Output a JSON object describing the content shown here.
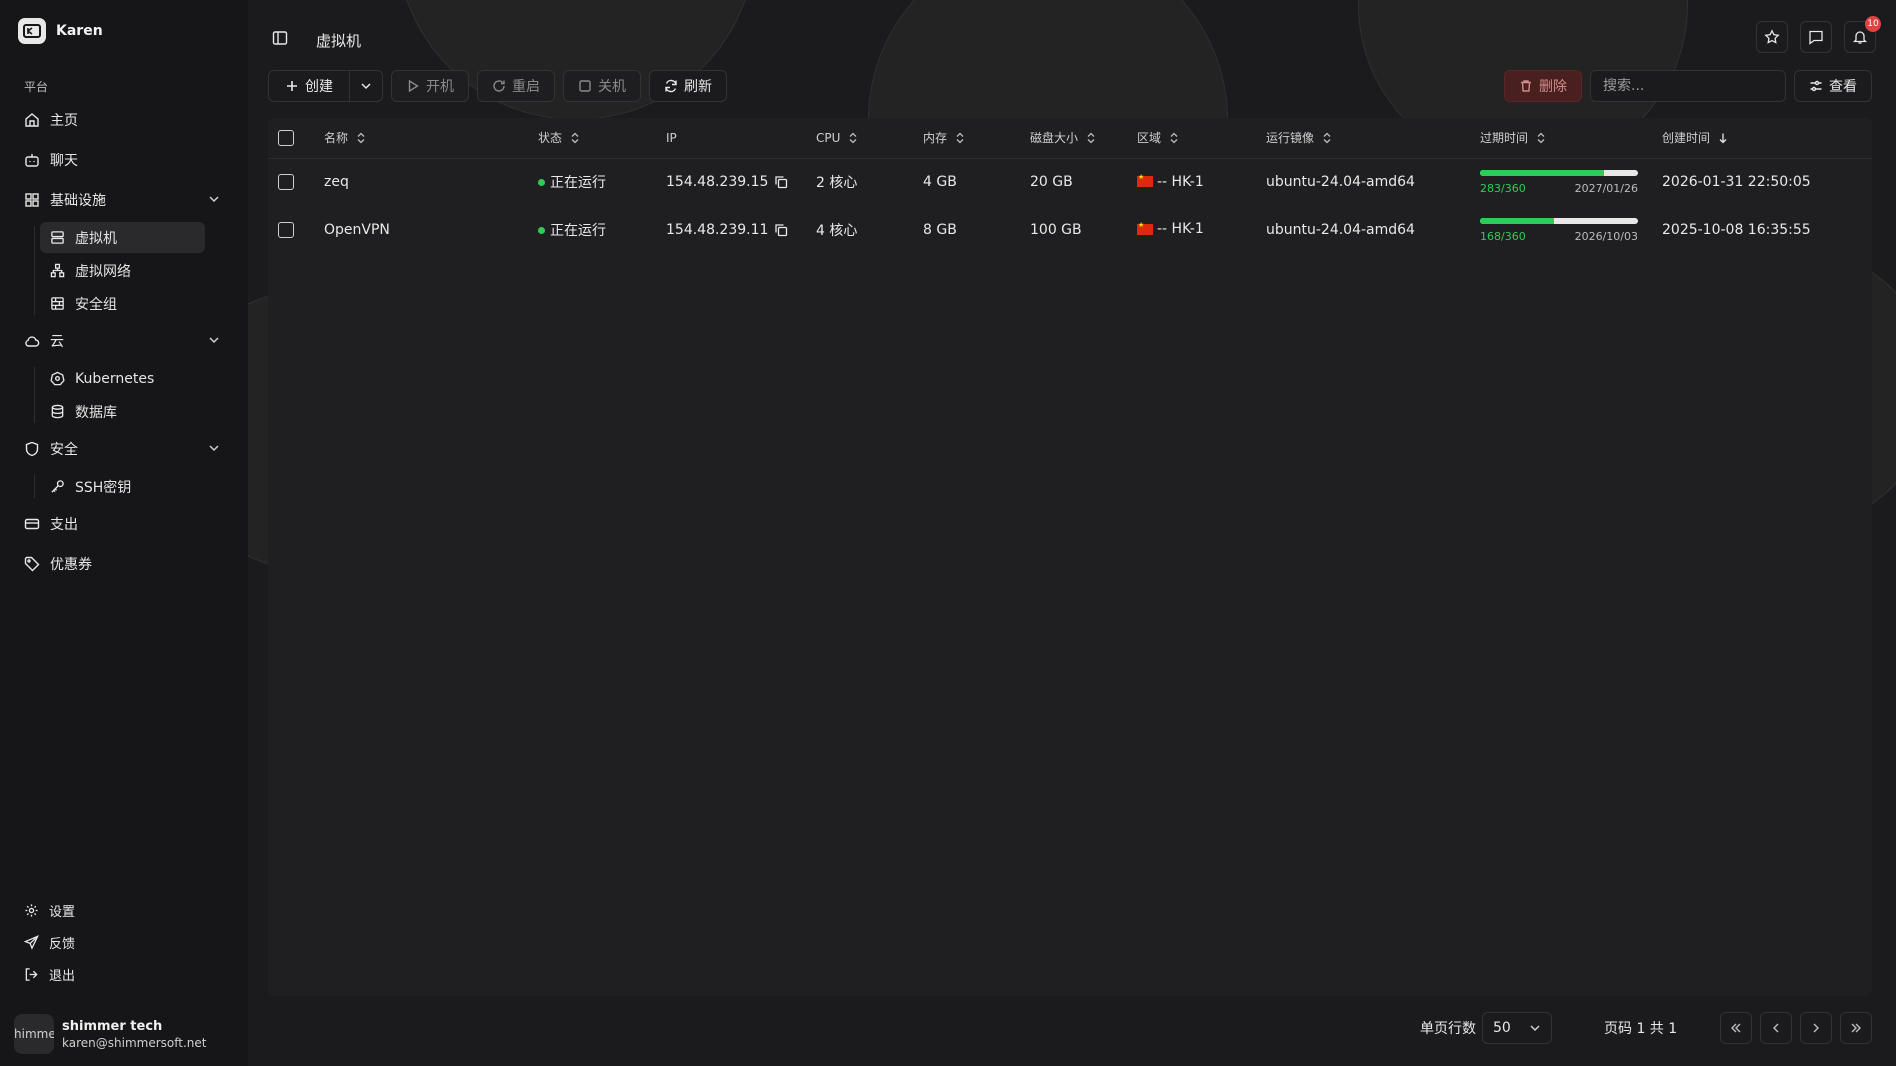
{
  "app": {
    "name": "Karen"
  },
  "sidebar": {
    "section_label": "平台",
    "items": [
      {
        "label": "主页",
        "icon": "home-icon"
      },
      {
        "label": "聊天",
        "icon": "bot-icon"
      },
      {
        "label": "基础设施",
        "icon": "grid-icon",
        "expanded": true,
        "children": [
          {
            "label": "虚拟机",
            "icon": "server-icon",
            "active": true
          },
          {
            "label": "虚拟网络",
            "icon": "network-icon"
          },
          {
            "label": "安全组",
            "icon": "firewall-icon"
          }
        ]
      },
      {
        "label": "云",
        "icon": "cloud-icon",
        "expanded": true,
        "children": [
          {
            "label": "Kubernetes",
            "icon": "kubernetes-icon"
          },
          {
            "label": "数据库",
            "icon": "database-icon"
          }
        ]
      },
      {
        "label": "安全",
        "icon": "shield-icon",
        "expanded": true,
        "children": [
          {
            "label": "SSH密钥",
            "icon": "key-icon"
          }
        ]
      },
      {
        "label": "支出",
        "icon": "credit-card-icon"
      },
      {
        "label": "优惠券",
        "icon": "tag-icon"
      }
    ],
    "bottom": [
      {
        "label": "设置",
        "icon": "gear-icon"
      },
      {
        "label": "反馈",
        "icon": "send-icon"
      },
      {
        "label": "退出",
        "icon": "logout-icon"
      }
    ],
    "user": {
      "avatar_text": "himme",
      "name": "shimmer tech",
      "email": "karen@shimmersoft.net"
    }
  },
  "header": {
    "title": "虚拟机",
    "notification_count": "10"
  },
  "toolbar": {
    "create": "创建",
    "power_on": "开机",
    "restart": "重启",
    "shutdown": "关机",
    "refresh": "刷新",
    "delete": "删除",
    "search_placeholder": "搜索...",
    "view": "查看"
  },
  "table": {
    "columns": [
      "名称",
      "状态",
      "IP",
      "CPU",
      "内存",
      "磁盘大小",
      "区域",
      "运行镜像",
      "过期时间",
      "创建时间"
    ],
    "rows": [
      {
        "name": "zeq",
        "status": "正在运行",
        "ip": "154.48.239.15",
        "cpu": "2 核心",
        "memory": "4 GB",
        "disk": "20 GB",
        "region": "-- HK-1",
        "image": "ubuntu-24.04-amd64",
        "expiry_days": "283/360",
        "expiry_fraction": 0.786,
        "expiry_date": "2027/01/26",
        "created": "2026-01-31 22:50:05"
      },
      {
        "name": "OpenVPN",
        "status": "正在运行",
        "ip": "154.48.239.11",
        "cpu": "4 核心",
        "memory": "8 GB",
        "disk": "100 GB",
        "region": "-- HK-1",
        "image": "ubuntu-24.04-amd64",
        "expiry_days": "168/360",
        "expiry_fraction": 0.467,
        "expiry_date": "2026/10/03",
        "created": "2025-10-08 16:35:55"
      }
    ]
  },
  "pagination": {
    "rows_per_page_label": "单页行数",
    "rows_per_page": "50",
    "page_info": "页码 1 共 1"
  },
  "colors": {
    "accent": "#2ecc55",
    "delete_bg": "#4a1f1f",
    "badge": "#e0433f"
  }
}
